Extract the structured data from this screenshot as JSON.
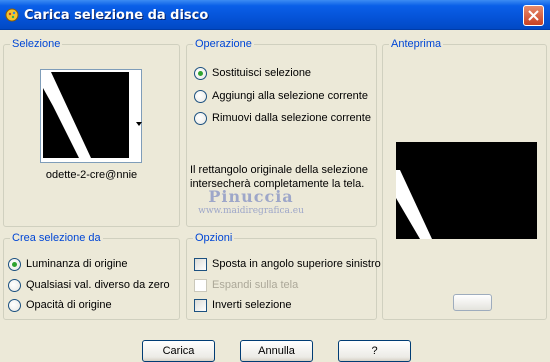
{
  "window": {
    "title": "Carica selezione da disco",
    "app_icon": "paint-shop-pro-icon",
    "close_icon": "close-icon"
  },
  "selezione": {
    "label": "Selezione",
    "file_name": "odette-2-cre@nnie"
  },
  "operazione": {
    "label": "Operazione",
    "options": [
      {
        "label": "Sostituisci selezione",
        "checked": true
      },
      {
        "label": "Aggiungi alla selezione corrente",
        "checked": false
      },
      {
        "label": "Rimuovi dalla selezione corrente",
        "checked": false
      }
    ],
    "info": "Il rettangolo originale della selezione intersecherà completamente la tela."
  },
  "anteprima": {
    "label": "Anteprima"
  },
  "crea_selezione": {
    "label": "Crea selezione da",
    "options": [
      {
        "label": "Luminanza di origine",
        "checked": true
      },
      {
        "label": "Qualsiasi val. diverso da zero",
        "checked": false
      },
      {
        "label": "Opacità di origine",
        "checked": false
      }
    ]
  },
  "opzioni": {
    "label": "Opzioni",
    "items": [
      {
        "label": "Sposta in angolo superiore sinistro",
        "checked": false,
        "disabled": false
      },
      {
        "label": "Espandi sulla tela",
        "checked": false,
        "disabled": true
      },
      {
        "label": "Inverti selezione",
        "checked": false,
        "disabled": false
      }
    ]
  },
  "watermark": {
    "title": "Pinuccia",
    "url": "www.maidiregrafica.eu"
  },
  "buttons": {
    "ok": "Carica",
    "cancel": "Annulla",
    "help": "?"
  },
  "colors": {
    "titlebar": "#0553D8",
    "dialog_bg": "#ECE9D8",
    "group_label": "#0046D5",
    "radio_selected": "#2FA32F",
    "disabled_text": "#ACA899"
  }
}
